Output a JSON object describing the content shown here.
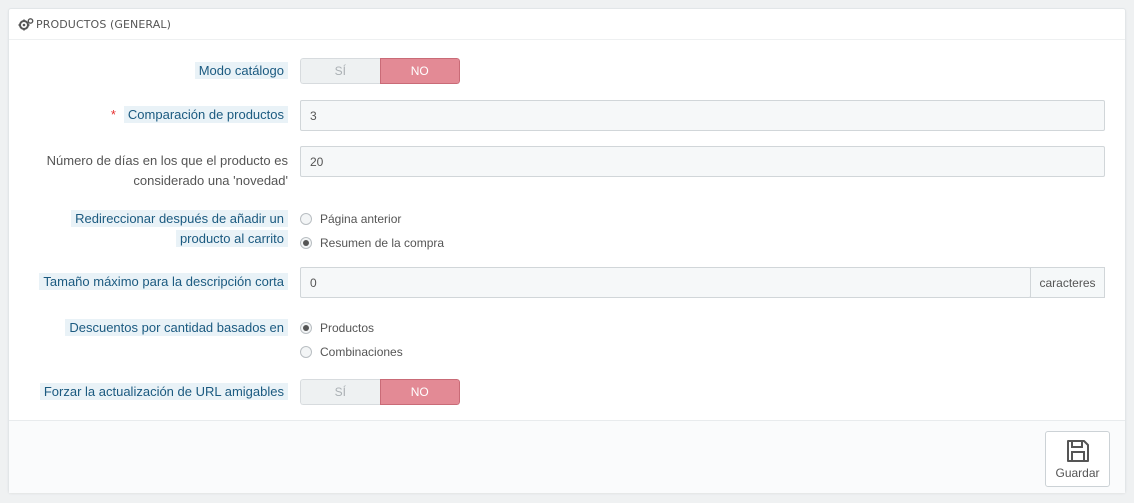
{
  "panel": {
    "title": "PRODUCTOS (GENERAL)",
    "icon": "cogs-icon"
  },
  "fields": {
    "catalog_mode": {
      "label": "Modo catálogo",
      "yes": "SÍ",
      "no": "NO",
      "value": "NO"
    },
    "product_comparison": {
      "required_mark": "*",
      "label": "Comparación de productos",
      "value": "3"
    },
    "new_days": {
      "label_line1": "Número de días en los que el producto es",
      "label_line2": "considerado una 'novedad'",
      "value": "20"
    },
    "redirect": {
      "label_line1": "Redireccionar después de añadir un",
      "label_line2": "producto al carrito",
      "options": [
        "Página anterior",
        "Resumen de la compra"
      ],
      "selected": "Resumen de la compra"
    },
    "short_desc": {
      "label": "Tamaño máximo para la descripción corta",
      "value": "0",
      "suffix": "caracteres"
    },
    "qty_discount": {
      "label": "Descuentos por cantidad basados en",
      "options": [
        "Productos",
        "Combinaciones"
      ],
      "selected": "Productos"
    },
    "force_friendly_url": {
      "label": "Forzar la actualización de URL amigables",
      "yes": "SÍ",
      "no": "NO",
      "value": "NO"
    }
  },
  "footer": {
    "save_label": "Guardar",
    "save_icon": "floppy-disk-icon"
  },
  "colors": {
    "label": "#1b5a80",
    "label_bg": "#e9f2f7",
    "switch_on": "#e38a95",
    "required": "#e62f2f"
  }
}
